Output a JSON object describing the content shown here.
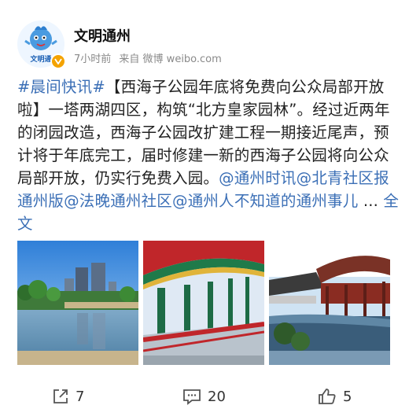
{
  "header": {
    "author": "文明通州",
    "avatar_label": "文明通",
    "time": "7小时前",
    "source": "来自 微博 weibo.com"
  },
  "post": {
    "tag": "#晨间快讯#",
    "body": "【西海子公园年底将免费向公众局部开放啦】一塔两湖四区，构筑“北方皇家园林”。经过近两年的闭园改造，西海子公园改扩建工程一期接近尾声，预计将于年底完工，届时修建一新的西海子公园将向公众局部开放，仍实行免费入园。",
    "mentions": [
      "@通州时讯",
      "@北青社区报通州版",
      "@法晚通州社区",
      "@通州人不知道的通州事儿"
    ],
    "ellipsis": " ... ",
    "more": "全文"
  },
  "actions": {
    "repost_count": "7",
    "comment_count": "20",
    "like_count": "5"
  },
  "colors": {
    "link": "#3b6fb6",
    "verified_badge": "#f4a300",
    "meta_text": "#8a8a8a"
  },
  "icons": {
    "repost": "share-arrow-box-icon",
    "comment": "comment-bubble-icon",
    "like": "thumbs-up-icon",
    "verified": "verified-v-icon"
  }
}
